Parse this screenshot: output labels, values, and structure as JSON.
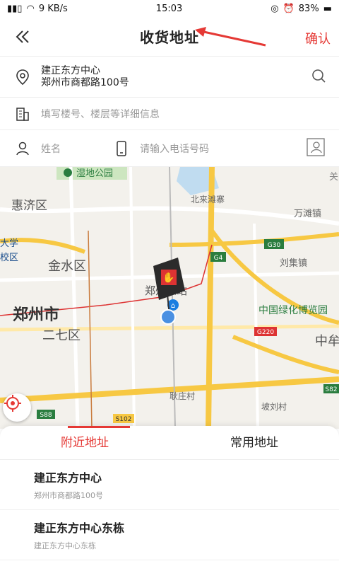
{
  "status_bar": {
    "signal": "ᵀ□ ☷",
    "speed": "9 KB/s",
    "time": "15:03",
    "battery": "83%"
  },
  "header": {
    "title": "收货地址",
    "confirm_label": "确认"
  },
  "address": {
    "line1": "建正东方中心",
    "line2": "郑州市商都路100号"
  },
  "detail_input": {
    "placeholder": "填写楼号、楼层等详细信息"
  },
  "name_input": {
    "placeholder": "姓名"
  },
  "phone_input": {
    "placeholder": "请输入电话号码"
  },
  "map": {
    "labels": {
      "wetland_park": "湿地公园",
      "huiji": "惠济区",
      "beilaiyingzhai": "北来滩寨",
      "wanshengzhen": "万滩镇",
      "university": "大学",
      "jinshui": "金水区",
      "liujizhen": "刘集镇",
      "zhengzhou": "郑州市",
      "station": "郑州东站",
      "station_short": "站",
      "erqi": "二七区",
      "green_expo": "中国绿化博览园",
      "zhongmou": "中牟",
      "lianzhuang": "耿庄村",
      "boliuCun": "坡刘村",
      "left_edge": "校区",
      "top_right": "关"
    },
    "road_shields": {
      "g4": "G4",
      "g30": "G30",
      "g220": "G220",
      "s88": "S88",
      "s102": "S102",
      "s82": "S82"
    }
  },
  "tabs": [
    {
      "label": "附近地址",
      "active": true
    },
    {
      "label": "常用地址",
      "active": false
    }
  ],
  "nearby": [
    {
      "name": "建正东方中心",
      "sub": "郑州市商都路100号"
    },
    {
      "name": "建正东方中心东栋",
      "sub": "建正东方中心东栋"
    }
  ],
  "colors": {
    "accent": "#e53935",
    "map_bg": "#f3f1ec",
    "highway": "#f7c843",
    "main_road": "#ffe9a8"
  }
}
